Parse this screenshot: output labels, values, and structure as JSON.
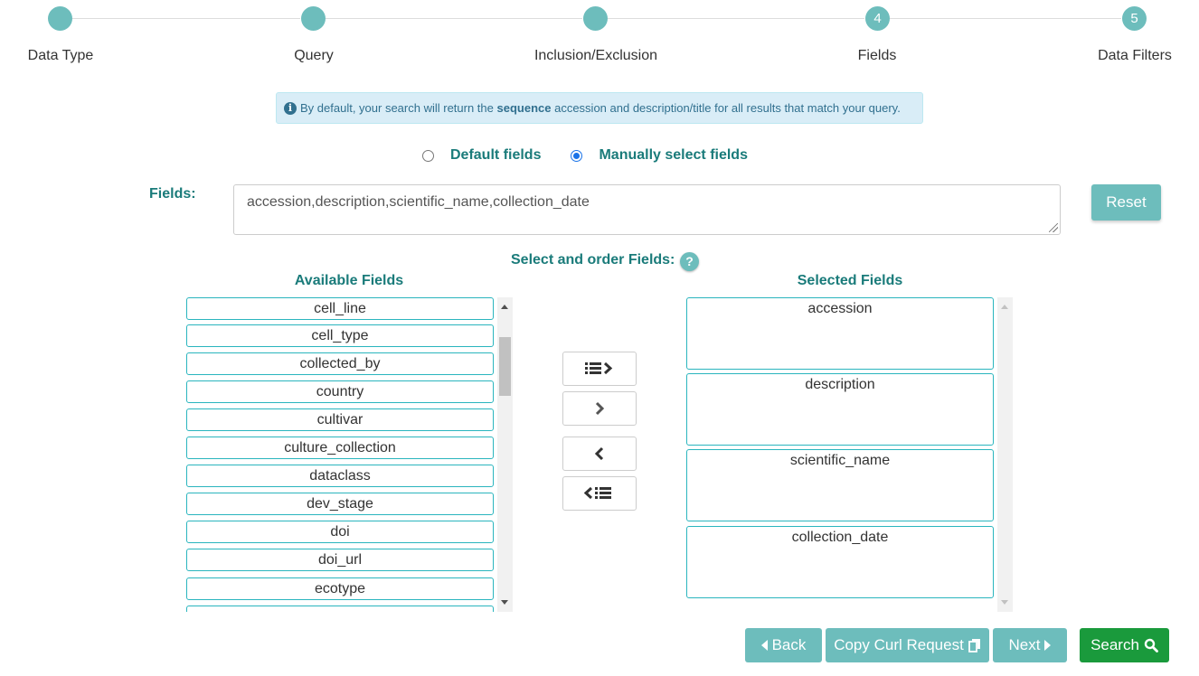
{
  "stepper": {
    "steps": [
      {
        "label": "Data Type",
        "number": ""
      },
      {
        "label": "Query",
        "number": ""
      },
      {
        "label": "Inclusion/Exclusion",
        "number": ""
      },
      {
        "label": "Fields",
        "number": "4"
      },
      {
        "label": "Data Filters",
        "number": "5"
      }
    ],
    "completed_color": "#6dbdbc"
  },
  "info": {
    "prefix": "By default, your search will return the ",
    "bold": "sequence",
    "suffix": " accession and description/title for all results that match your query.",
    "icon": "info-circle-icon"
  },
  "field_mode": {
    "options": [
      {
        "label": "Default fields",
        "selected": false
      },
      {
        "label": "Manually select fields",
        "selected": true
      }
    ]
  },
  "fields": {
    "label": "Fields:",
    "value": "accession,description,scientific_name,collection_date",
    "reset_label": "Reset"
  },
  "selector": {
    "title": "Select and order Fields:",
    "help": "?",
    "available_title": "Available Fields",
    "selected_title": "Selected Fields",
    "available": [
      "cell_line",
      "cell_type",
      "collected_by",
      "country",
      "cultivar",
      "culture_collection",
      "dataclass",
      "dev_stage",
      "doi",
      "doi_url",
      "ecotype"
    ],
    "selected": [
      "accession",
      "description",
      "scientific_name",
      "collection_date"
    ],
    "move_buttons": [
      "move-all-right-icon",
      "move-right-icon",
      "move-left-icon",
      "move-all-left-icon"
    ]
  },
  "actions": {
    "back": "Back",
    "copy_curl": "Copy Curl Request",
    "next": "Next",
    "search": "Search"
  },
  "colors": {
    "accent": "#6dbdbc",
    "heading": "#1a7b7a",
    "item_border": "#2ab5be",
    "search": "#1a9a3c"
  }
}
